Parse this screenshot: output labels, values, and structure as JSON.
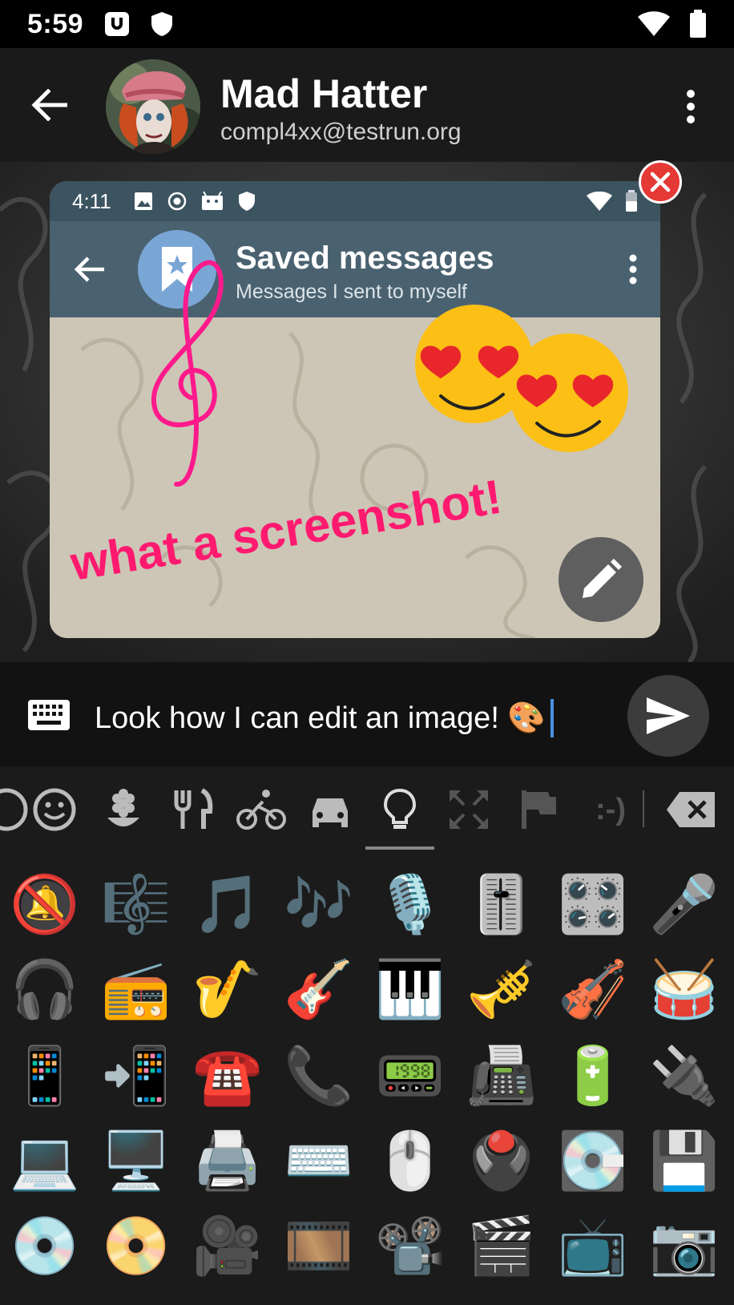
{
  "status_bar": {
    "time": "5:59"
  },
  "header": {
    "contact_name": "Mad Hatter",
    "contact_address": "compl4xx@testrun.org"
  },
  "preview": {
    "status_time": "4:11",
    "title": "Saved messages",
    "subtitle": "Messages I sent to myself",
    "caption_art": "what a screenshot!"
  },
  "composer": {
    "text": "Look how I can edit an image! 🎨"
  },
  "emoji_tabs": [
    {
      "name": "tab-recent",
      "icon": "clock-icon"
    },
    {
      "name": "tab-smileys",
      "icon": "smiley-icon"
    },
    {
      "name": "tab-nature",
      "icon": "flower-icon"
    },
    {
      "name": "tab-food",
      "icon": "fork-knife-icon"
    },
    {
      "name": "tab-activity",
      "icon": "bicycle-icon"
    },
    {
      "name": "tab-travel",
      "icon": "car-icon"
    },
    {
      "name": "tab-objects",
      "icon": "lightbulb-icon",
      "selected": true
    },
    {
      "name": "tab-symbols",
      "icon": "expand-icon"
    },
    {
      "name": "tab-flags",
      "icon": "flag-icon"
    },
    {
      "name": "tab-emoticons",
      "icon": ":-)"
    }
  ],
  "emoji_rows": [
    [
      "🔕",
      "🎼",
      "🎵",
      "🎶",
      "🎙️",
      "🎚️",
      "🎛️",
      "🎤"
    ],
    [
      "🎧",
      "📻",
      "🎷",
      "🎸",
      "🎹",
      "🎺",
      "🎻",
      "🥁"
    ],
    [
      "📱",
      "📲",
      "☎️",
      "📞",
      "📟",
      "📠",
      "🔋",
      "🔌"
    ],
    [
      "💻",
      "🖥️",
      "🖨️",
      "⌨️",
      "🖱️",
      "🖲️",
      "💽",
      "💾"
    ],
    [
      "💿",
      "📀",
      "🎥",
      "🎞️",
      "📽️",
      "🎬",
      "📺",
      "📷"
    ]
  ],
  "colors": {
    "accent_caret": "#4a90e2",
    "close": "#e53935",
    "drawing_pink": "#ff1a8c"
  }
}
